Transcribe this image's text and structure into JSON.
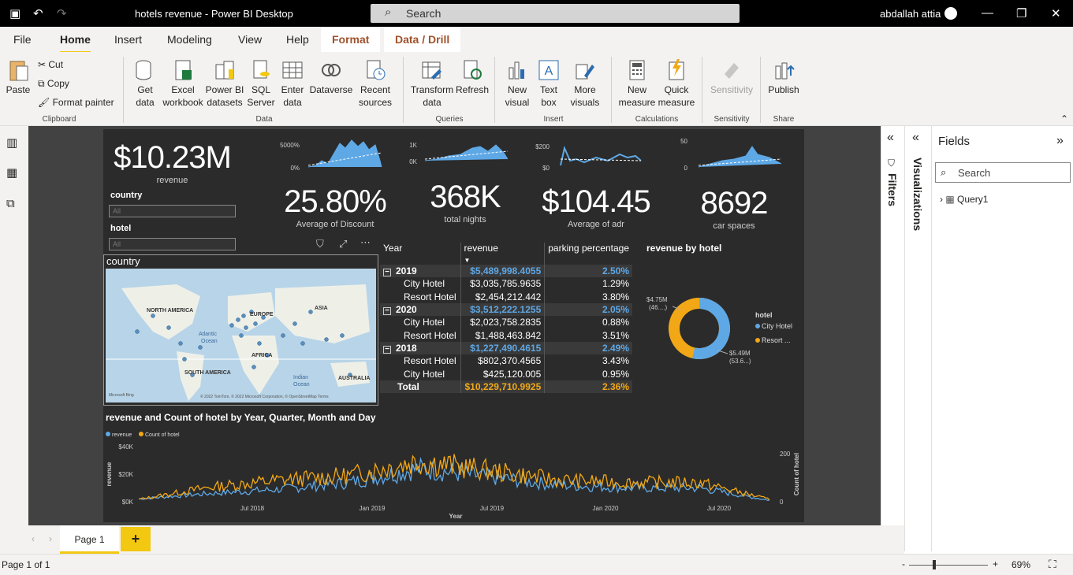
{
  "window": {
    "title": "hotels revenue - Power BI Desktop",
    "search": "Search",
    "user": "abdallah attia"
  },
  "tabs": [
    "File",
    "Home",
    "Insert",
    "Modeling",
    "View",
    "Help"
  ],
  "context_tabs": [
    "Format",
    "Data / Drill"
  ],
  "ribbon": {
    "paste": "Paste",
    "cut": "Cut",
    "copy": "Copy",
    "format_painter": "Format painter",
    "clipboard": "Clipboard",
    "get_data": [
      "Get",
      "data"
    ],
    "excel": [
      "Excel",
      "workbook"
    ],
    "pbi": [
      "Power BI",
      "datasets"
    ],
    "sql": [
      "SQL",
      "Server"
    ],
    "enter": [
      "Enter",
      "data"
    ],
    "dataverse": "Dataverse",
    "recent": [
      "Recent",
      "sources"
    ],
    "data_group": "Data",
    "transform": [
      "Transform",
      "data"
    ],
    "refresh": "Refresh",
    "queries_group": "Queries",
    "new_visual": [
      "New",
      "visual"
    ],
    "text_box": [
      "Text",
      "box"
    ],
    "more_visuals": [
      "More",
      "visuals"
    ],
    "insert_group": "Insert",
    "new_measure": [
      "New",
      "measure"
    ],
    "quick_measure": [
      "Quick",
      "measure"
    ],
    "calc_group": "Calculations",
    "sensitivity": "Sensitivity",
    "sensitivity_group": "Sensitivity",
    "publish": "Publish",
    "share_group": "Share"
  },
  "kpis": {
    "revenue": {
      "value": "$10.23M",
      "label": "revenue"
    },
    "discount": {
      "value": "25.80%",
      "label": "Average of Discount"
    },
    "nights": {
      "value": "368K",
      "label": "total nights"
    },
    "adr": {
      "value": "$104.45",
      "label": "Average of adr"
    },
    "car": {
      "value": "8692",
      "label": "car spaces"
    }
  },
  "sparks": {
    "s1": [
      "5000%",
      "0%"
    ],
    "s2": [
      "1K",
      "0K"
    ],
    "s3": [
      "$200",
      "$0"
    ],
    "s4": [
      "50",
      "0"
    ]
  },
  "slicers": {
    "country": {
      "label": "country",
      "value": "All"
    },
    "hotel": {
      "label": "hotel",
      "value": "All"
    }
  },
  "map": {
    "title": "country",
    "labels": [
      "NORTH AMERICA",
      "EUROPE",
      "ASIA",
      "Atlantic",
      "Ocean",
      "AFRICA",
      "SOUTH AMERICA",
      "Indian",
      "Ocean",
      "AUSTRALIA"
    ],
    "credit": "© 2022 TomTom, © 2022 Microsoft Corporation, © OpenStreetMap   Terms",
    "brand": "Microsoft Bing"
  },
  "table": {
    "headers": [
      "Year",
      "revenue",
      "parking percentage"
    ],
    "rows": [
      {
        "label": "2019",
        "revenue": "$5,489,998.4055",
        "pct": "2.50%",
        "type": "year"
      },
      {
        "label": "City Hotel",
        "revenue": "$3,035,785.9635",
        "pct": "1.29%",
        "type": "child"
      },
      {
        "label": "Resort Hotel",
        "revenue": "$2,454,212.442",
        "pct": "3.80%",
        "type": "child"
      },
      {
        "label": "2020",
        "revenue": "$3,512,222.1255",
        "pct": "2.05%",
        "type": "year"
      },
      {
        "label": "City Hotel",
        "revenue": "$2,023,758.2835",
        "pct": "0.88%",
        "type": "child"
      },
      {
        "label": "Resort Hotel",
        "revenue": "$1,488,463.842",
        "pct": "3.51%",
        "type": "child"
      },
      {
        "label": "2018",
        "revenue": "$1,227,490.4615",
        "pct": "2.49%",
        "type": "year"
      },
      {
        "label": "Resort Hotel",
        "revenue": "$802,370.4565",
        "pct": "3.43%",
        "type": "child"
      },
      {
        "label": "City Hotel",
        "revenue": "$425,120.005",
        "pct": "0.95%",
        "type": "child"
      },
      {
        "label": "Total",
        "revenue": "$10,229,710.9925",
        "pct": "2.36%",
        "type": "total"
      }
    ]
  },
  "donut": {
    "title": "revenue by hotel",
    "legend_title": "hotel",
    "labels": [
      "$4.75M",
      "(46....)",
      "$5.49M",
      "(53.6...)"
    ],
    "legend": [
      "City Hotel",
      "Resort ..."
    ]
  },
  "chart_data": {
    "type": "line",
    "title": "revenue and Count of hotel by Year, Quarter, Month and Day",
    "series": [
      {
        "name": "revenue",
        "color": "#5ea8e6"
      },
      {
        "name": "Count of hotel",
        "color": "#f2a816"
      }
    ],
    "xlabel": "Year",
    "ylabel": "revenue",
    "y2label": "Count of hotel",
    "yticks": [
      "$40K",
      "$20K",
      "$0K"
    ],
    "y2ticks": [
      "200",
      "0"
    ],
    "xticks": [
      "Jul 2018",
      "Jan 2019",
      "Jul 2019",
      "Jan 2020",
      "Jul 2020"
    ],
    "ylim": [
      0,
      40000
    ],
    "y2lim": [
      0,
      230
    ],
    "x": [
      "2018-07",
      "2018-10",
      "2019-01",
      "2019-04",
      "2019-07",
      "2019-10",
      "2020-01",
      "2020-04",
      "2020-07",
      "2020-09"
    ],
    "revenue": [
      2000,
      6000,
      9000,
      14000,
      24000,
      18000,
      12000,
      10000,
      10000,
      1000
    ],
    "count": [
      10,
      60,
      90,
      110,
      170,
      130,
      90,
      80,
      80,
      10
    ]
  },
  "fields": {
    "title": "Fields",
    "search": "Search",
    "table": "Query1"
  },
  "panes": {
    "filters": "Filters",
    "visualizations": "Visualizations"
  },
  "page": {
    "tab": "Page 1",
    "add": "+"
  },
  "status": {
    "page": "Page 1 of 1",
    "zoom": "69%",
    "minus": "-",
    "plus": "+"
  }
}
